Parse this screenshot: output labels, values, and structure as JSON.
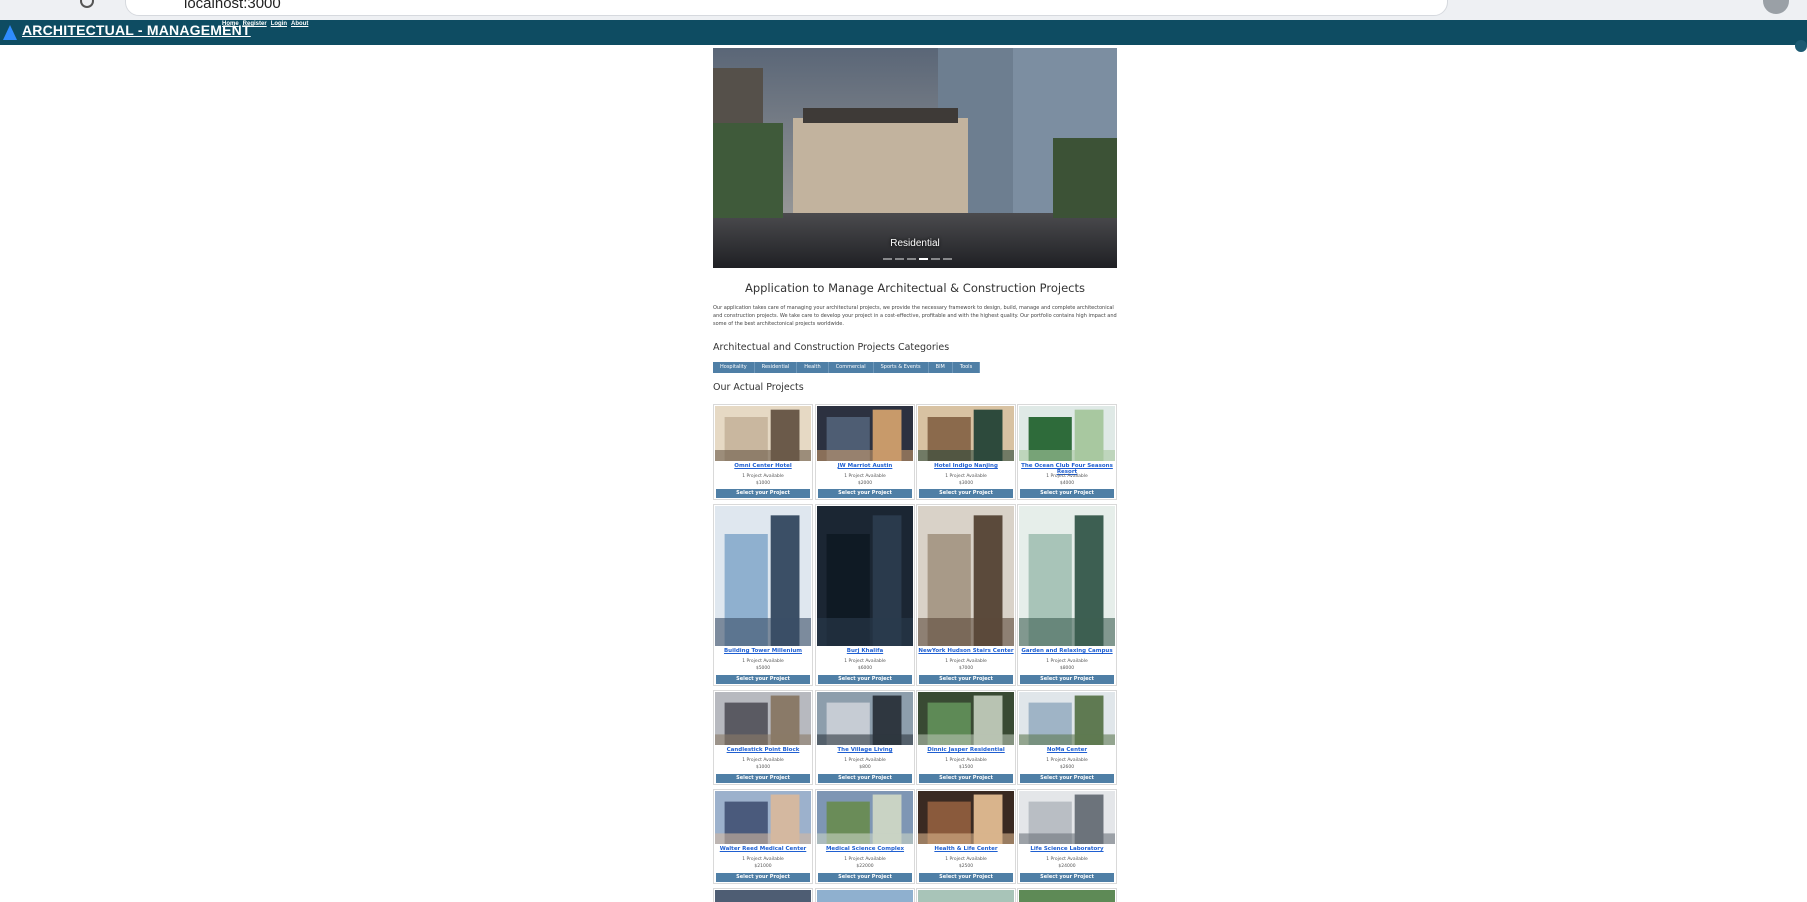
{
  "browser": {
    "url": "localhost:3000"
  },
  "navbar": {
    "brand": "ARCHITECTUAL - MANAGEMENT",
    "links": [
      "Home",
      "Register",
      "Login",
      "About"
    ],
    "background_color": "#0e4c62",
    "brand_icon": "triangle-logo-icon",
    "cart_icon": "cart-icon"
  },
  "hero": {
    "caption": "Residential",
    "slide_count": 6,
    "active_slide": 4
  },
  "main": {
    "title": "Application to Manage Architectual & Construction Projects",
    "description": "Our application takes care of managing your architectural projects, we provide the necessary framework to design, build, manage and complete architectonical and construction projects. We take care to develop your project in a cost-effective, profitable and with the highest quality. Our portfolio contains high impact and some of the best architectonical projects worldwide.",
    "categories_title": "Architectual and Construction Projects Categories",
    "categories": [
      "Hospitality",
      "Residential",
      "Health",
      "Commercial",
      "Sports & Events",
      "BIM",
      "Tools"
    ],
    "projects_title": "Our Actual Projects",
    "button_label": "Select your Project",
    "projects": [
      {
        "name": "Omni Center Hotel",
        "availability": "1 Project Available",
        "price": "$1000"
      },
      {
        "name": "JW Marriot Austin",
        "availability": "1 Project Available",
        "price": "$2000"
      },
      {
        "name": "Hotel Indigo Nanjing",
        "availability": "1 Project Available",
        "price": "$3000"
      },
      {
        "name": "The Ocean Club Four Seasons Resort",
        "availability": "1 Project Available",
        "price": "$4000"
      },
      {
        "name": "Building Tower Millenium",
        "availability": "1 Project Available",
        "price": "$5000"
      },
      {
        "name": "Burj Khalifa",
        "availability": "1 Project Available",
        "price": "$6000"
      },
      {
        "name": "NewYork Hudson Stairs Center",
        "availability": "1 Project Available",
        "price": "$7000"
      },
      {
        "name": "Garden and Relaxing Campus",
        "availability": "1 Project Available",
        "price": "$8000"
      },
      {
        "name": "Candlestick Point Block",
        "availability": "1 Project Available",
        "price": "$1000"
      },
      {
        "name": "The Village Living",
        "availability": "1 Project Available",
        "price": "$800"
      },
      {
        "name": "Dinnic Jasper Residential",
        "availability": "1 Project Available",
        "price": "$1500"
      },
      {
        "name": "NoMa Center",
        "availability": "1 Project Available",
        "price": "$2600"
      },
      {
        "name": "Walter Reed Medical Center",
        "availability": "1 Project Available",
        "price": "$21000"
      },
      {
        "name": "Medical Science Complex",
        "availability": "1 Project Available",
        "price": "$22000"
      },
      {
        "name": "Health & Life Center",
        "availability": "1 Project Available",
        "price": "$2500"
      },
      {
        "name": "Life Science Laboratory",
        "availability": "1 Project Available",
        "price": "$24000"
      }
    ]
  }
}
